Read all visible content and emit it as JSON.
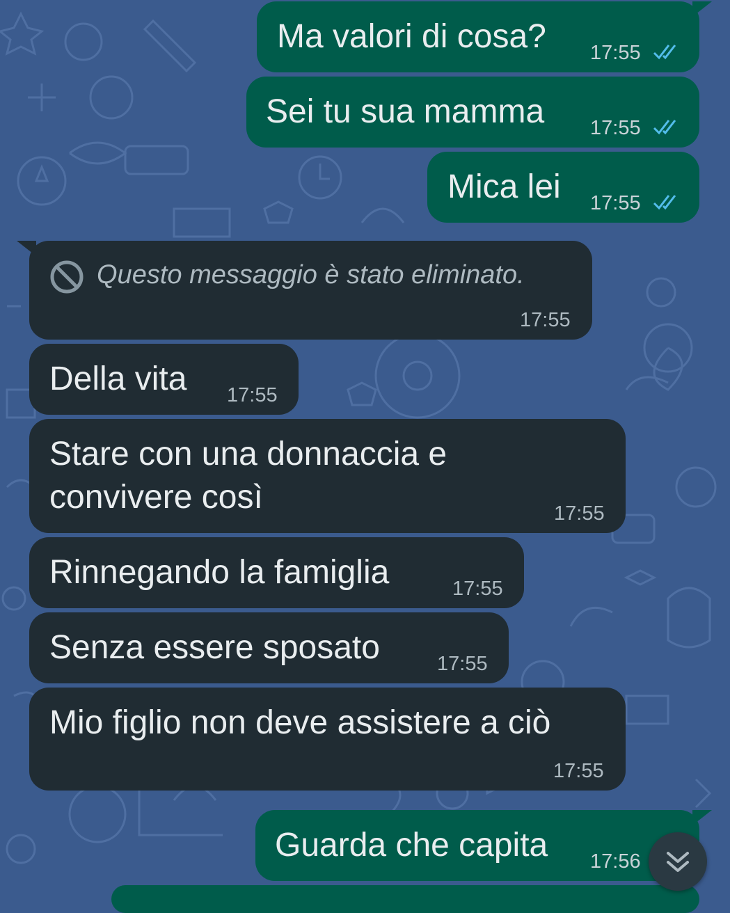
{
  "theme": {
    "wallpaper": "#3b5b8e",
    "outgoing_bubble": "#005c4b",
    "incoming_bubble": "#202c33",
    "read_ticks": "#53bdeb"
  },
  "messages": [
    {
      "direction": "out",
      "text": "Ma valori di cosa?",
      "time": "17:55",
      "status": "read"
    },
    {
      "direction": "out",
      "text": "Sei tu sua mamma",
      "time": "17:55",
      "status": "read"
    },
    {
      "direction": "out",
      "text": "Mica lei",
      "time": "17:55",
      "status": "read"
    },
    {
      "direction": "in",
      "deleted": true,
      "text": "Questo messaggio è stato eliminato.",
      "time": "17:55",
      "icon": "prohibited-icon"
    },
    {
      "direction": "in",
      "text": "Della vita",
      "time": "17:55"
    },
    {
      "direction": "in",
      "text_lines": [
        "Stare con una donnaccia e",
        "convivere così"
      ],
      "time": "17:55"
    },
    {
      "direction": "in",
      "text": "Rinnegando la famiglia",
      "time": "17:55"
    },
    {
      "direction": "in",
      "text": "Senza essere sposato",
      "time": "17:55"
    },
    {
      "direction": "in",
      "text": "Mio figlio non deve assistere a ciò",
      "time": "17:55"
    },
    {
      "direction": "out",
      "text": "Guarda che capita",
      "time": "17:56"
    }
  ],
  "scroll_button": {
    "icon": "double-chevron-down-icon"
  }
}
